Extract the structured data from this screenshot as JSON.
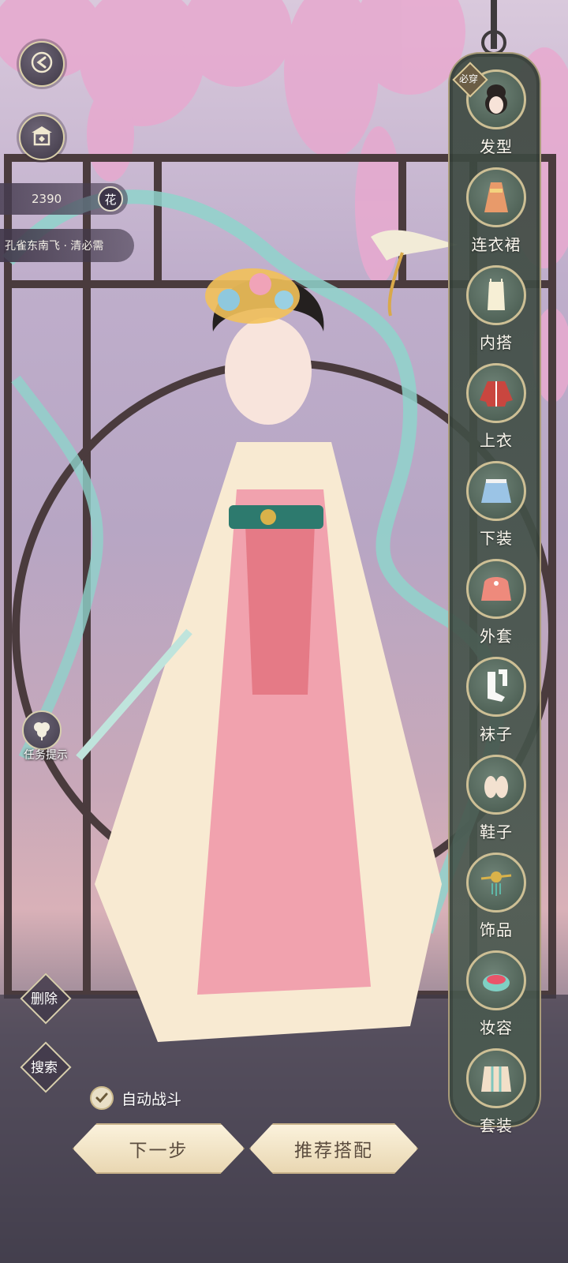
{
  "nav": {
    "back_icon": "back-arrow-icon",
    "home_icon": "pavilion-home-icon"
  },
  "currency": {
    "amount": "2390",
    "badge": "花"
  },
  "stage": {
    "title": "孔雀东南飞 · 清必需"
  },
  "hint": {
    "label": "任务提示",
    "icon": "clover-icon"
  },
  "actions": {
    "delete_label": "删除",
    "search_label": "搜索",
    "auto_battle_label": "自动战斗",
    "auto_battle_checked": true,
    "next_label": "下一步",
    "recommend_label": "推荐搭配"
  },
  "categories": {
    "must_badge": "必穿",
    "items": [
      {
        "label": "发型",
        "icon": "hairstyle-icon"
      },
      {
        "label": "连衣裙",
        "icon": "dress-icon"
      },
      {
        "label": "内搭",
        "icon": "inner-top-icon"
      },
      {
        "label": "上衣",
        "icon": "jacket-icon"
      },
      {
        "label": "下装",
        "icon": "skirt-icon"
      },
      {
        "label": "外套",
        "icon": "coat-icon"
      },
      {
        "label": "袜子",
        "icon": "socks-icon"
      },
      {
        "label": "鞋子",
        "icon": "shoes-icon"
      },
      {
        "label": "饰品",
        "icon": "hairpin-accessory-icon"
      },
      {
        "label": "妆容",
        "icon": "makeup-icon"
      },
      {
        "label": "套装",
        "icon": "outfit-set-icon"
      }
    ]
  },
  "colors": {
    "panel": "#4a5a50",
    "gold_border": "#cdbf95",
    "button_bg": "#fbf2dc",
    "button_text": "#5b4c3e"
  }
}
